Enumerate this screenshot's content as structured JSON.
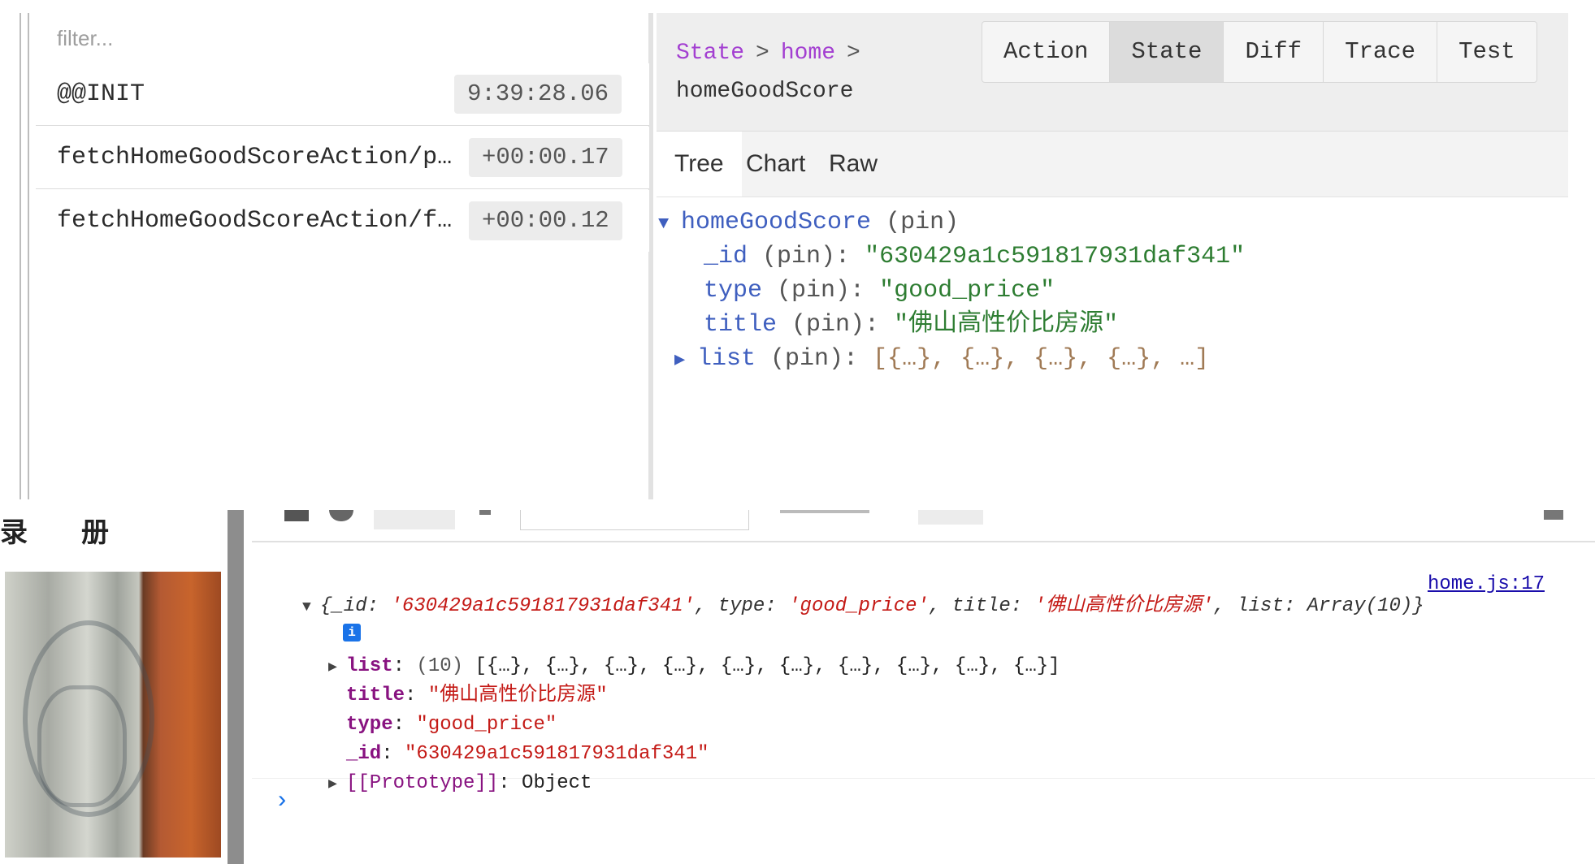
{
  "redux_devtools": {
    "filter_placeholder": "filter...",
    "actions": [
      {
        "name": "@@INIT",
        "time": "9:39:28.06"
      },
      {
        "name": "fetchHomeGoodScoreAction/p…",
        "time": "+00:00.17"
      },
      {
        "name": "fetchHomeGoodScoreAction/f…",
        "time": "+00:00.12"
      }
    ],
    "breadcrumb": {
      "items": [
        "State",
        "home"
      ],
      "separator": ">",
      "current": "homeGoodScore"
    },
    "tabs": [
      "Action",
      "State",
      "Diff",
      "Trace",
      "Test"
    ],
    "active_tab": "State",
    "subtabs": [
      "Tree",
      "Chart",
      "Raw"
    ],
    "active_subtab": "Tree",
    "tree": {
      "root_key": "homeGoodScore",
      "pin": "(pin)",
      "rows": [
        {
          "key": "_id",
          "value": "\"630429a1c591817931daf341\""
        },
        {
          "key": "type",
          "value": "\"good_price\""
        },
        {
          "key": "title",
          "value": "\"佛山高性价比房源\""
        }
      ],
      "collapsed_row": {
        "key": "list",
        "value": "[{…}, {…}, {…}, {…}, …]"
      }
    }
  },
  "page_preview": {
    "labels": [
      "录",
      "册"
    ]
  },
  "console": {
    "source_link": "home.js:17",
    "preview": {
      "open": "{",
      "id_key": "_id",
      "id_val": "'630429a1c591817931daf341'",
      "type_key": "type",
      "type_val": "'good_price'",
      "title_key": "title",
      "title_val": "'佛山高性价比房源'",
      "list_key": "list",
      "list_val": "Array(10)",
      "close": "}"
    },
    "info_badge": "i",
    "props": [
      {
        "key": "list",
        "count": "(10)",
        "value": "[{…}, {…}, {…}, {…}, {…}, {…}, {…}, {…}, {…}, {…}]"
      },
      {
        "key": "title",
        "value": "\"佛山高性价比房源\""
      },
      {
        "key": "type",
        "value": "\"good_price\""
      },
      {
        "key": "_id",
        "value": "\"630429a1c591817931daf341\""
      }
    ],
    "prototype": {
      "key": "[[Prototype]]",
      "value": "Object"
    },
    "prompt": "›"
  },
  "colors": {
    "breadcrumb_link": "#a33fd1",
    "tree_key": "#3f5fbf",
    "tree_string": "#2e7d32",
    "console_key": "#881280",
    "console_string": "#c41a16",
    "console_link": "#1a0dab"
  },
  "icons": {
    "tree_expanded": "triangle-down-icon",
    "tree_collapsed": "triangle-right-icon",
    "console_prompt": "chevron-right-icon",
    "info": "info-icon"
  }
}
